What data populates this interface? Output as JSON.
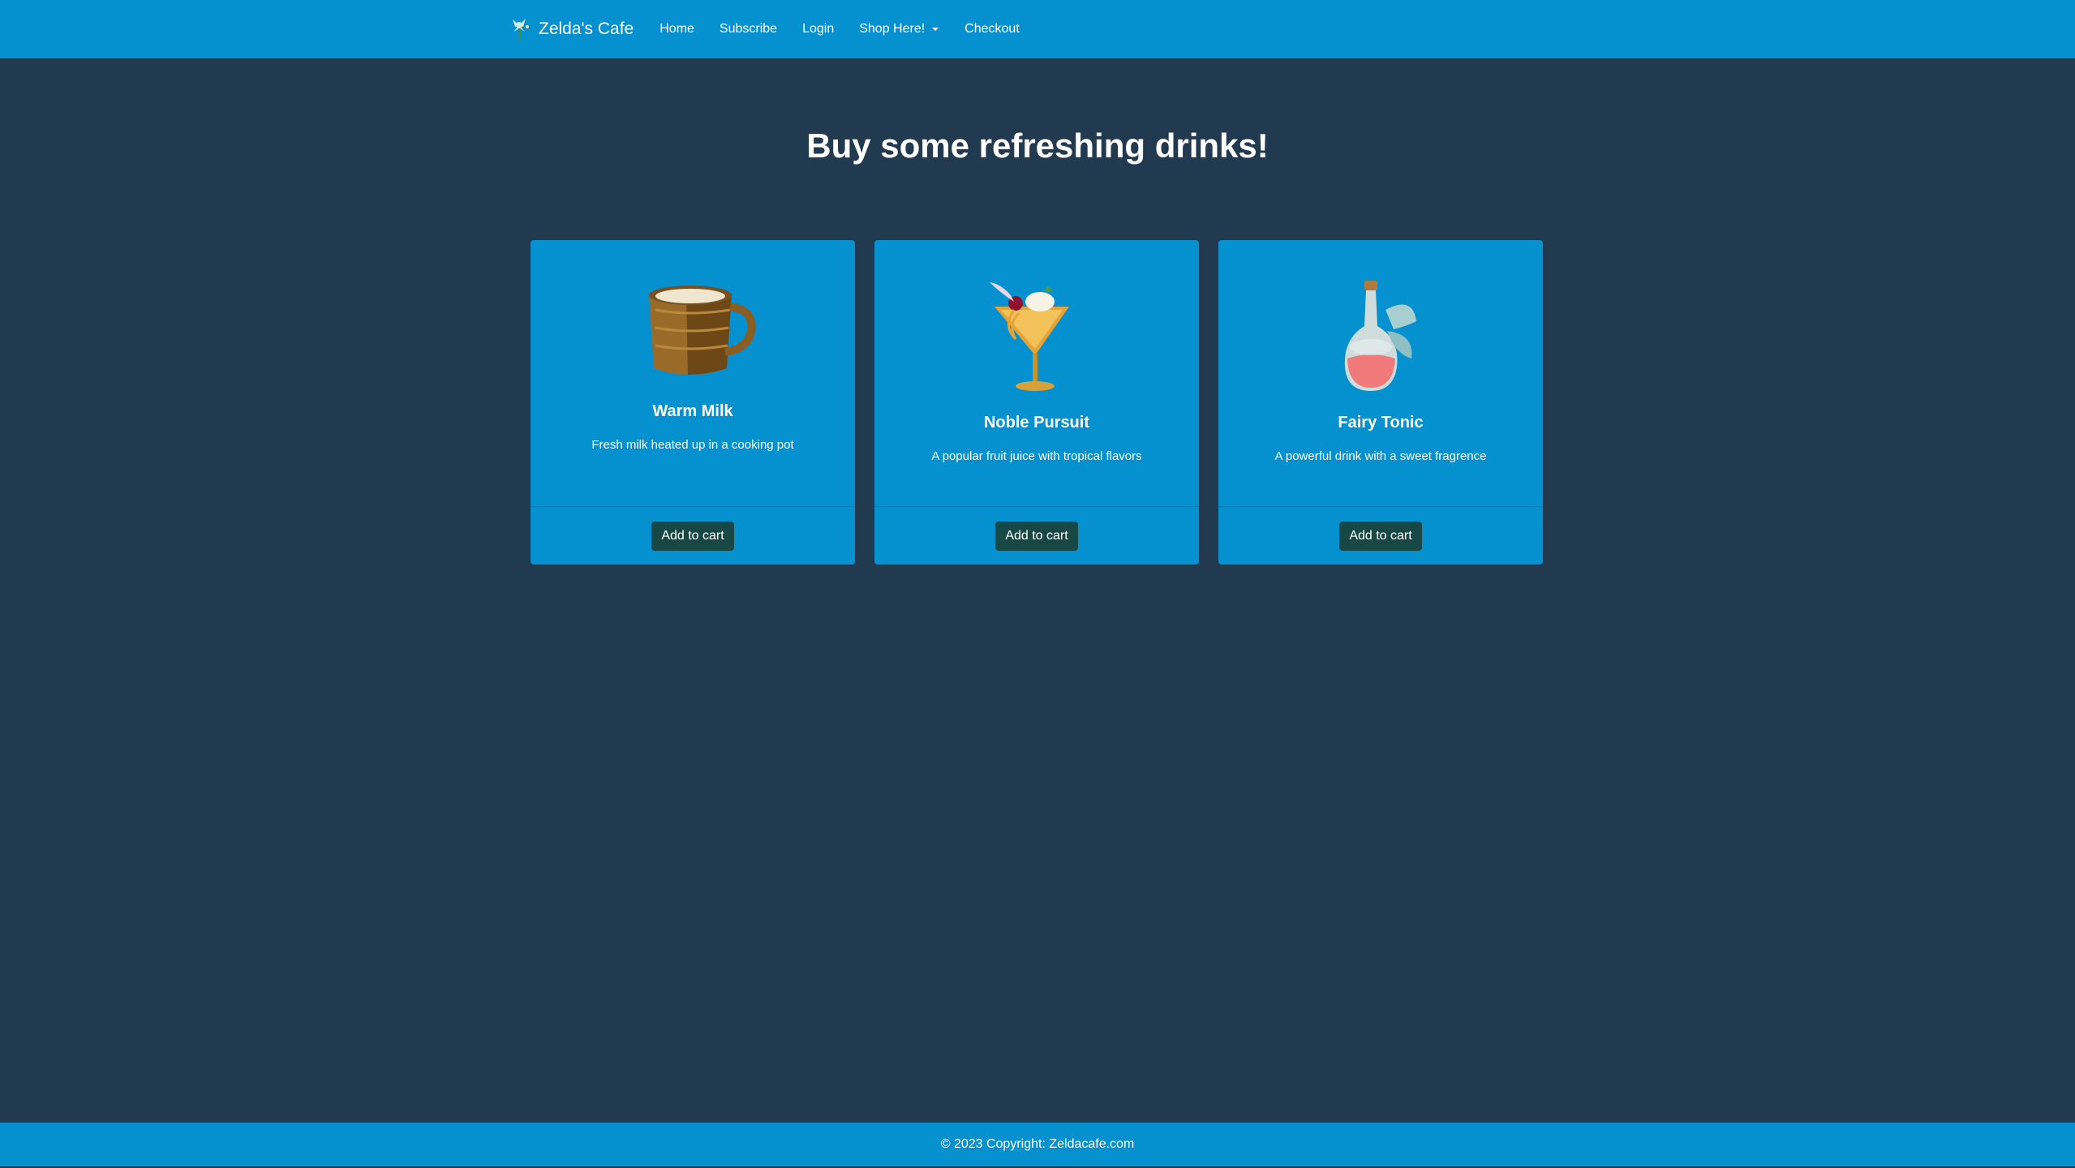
{
  "navbar": {
    "brand_icon": "fairy-icon",
    "brand": "Zelda's Cafe",
    "links": [
      "Home",
      "Subscribe",
      "Login",
      "Shop Here!",
      "Checkout"
    ],
    "dropdown_icon": "chevron-down-icon"
  },
  "main": {
    "heading": "Buy some refreshing drinks!",
    "products": [
      {
        "icon": "warm-milk-mug-icon",
        "name": "Warm Milk",
        "description": "Fresh milk heated up in a cooking pot",
        "button": "Add to cart"
      },
      {
        "icon": "cocktail-glass-icon",
        "name": "Noble Pursuit",
        "description": "A popular fruit juice with tropical flavors",
        "button": "Add to cart"
      },
      {
        "icon": "potion-bottle-icon",
        "name": "Fairy Tonic",
        "description": "A powerful drink with a sweet fragrence",
        "button": "Add to cart"
      }
    ]
  },
  "footer": {
    "copyright": "© 2023 Copyright: Zeldacafe.com"
  },
  "colors": {
    "navbar": "#0591cf",
    "background": "#213a4f",
    "card": "#0591cf",
    "button": "#174846"
  }
}
